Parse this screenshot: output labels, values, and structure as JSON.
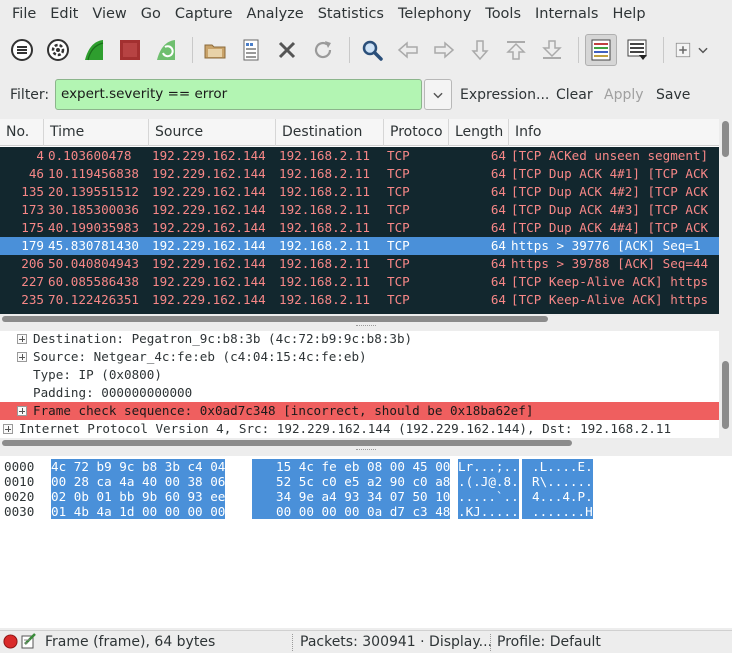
{
  "menu": [
    "File",
    "Edit",
    "View",
    "Go",
    "Capture",
    "Analyze",
    "Statistics",
    "Telephony",
    "Tools",
    "Internals",
    "Help"
  ],
  "toolbar": {
    "icons": [
      "interfaces-icon",
      "options-icon",
      "start-capture-icon",
      "stop-capture-icon",
      "restart-capture-icon",
      "open-file-icon",
      "save-file-icon",
      "close-file-icon",
      "reload-icon",
      "find-icon",
      "go-back-icon",
      "go-forward-icon",
      "go-to-packet-icon",
      "go-first-icon",
      "go-last-icon",
      "colorize-icon",
      "autoscroll-icon",
      "zoom-in-icon"
    ]
  },
  "filter": {
    "label": "Filter:",
    "value": "expert.severity == error",
    "expression_label": "Expression...",
    "clear_label": "Clear",
    "apply_label": "Apply",
    "save_label": "Save"
  },
  "packet_list": {
    "columns": [
      "No.",
      "Time",
      "Source",
      "Destination",
      "Protoco",
      "Length",
      "Info"
    ],
    "rows": [
      {
        "no": "4",
        "time": "0.103600478",
        "src": "192.229.162.144",
        "dst": "192.168.2.11",
        "proto": "TCP",
        "len": "64",
        "info": "[TCP ACKed unseen segment]",
        "style": "err"
      },
      {
        "no": "46",
        "time": "10.119456838",
        "src": "192.229.162.144",
        "dst": "192.168.2.11",
        "proto": "TCP",
        "len": "64",
        "info": "[TCP Dup ACK 4#1] [TCP ACK",
        "style": "err"
      },
      {
        "no": "135",
        "time": "20.139551512",
        "src": "192.229.162.144",
        "dst": "192.168.2.11",
        "proto": "TCP",
        "len": "64",
        "info": "[TCP Dup ACK 4#2] [TCP ACK",
        "style": "err"
      },
      {
        "no": "173",
        "time": "30.185300036",
        "src": "192.229.162.144",
        "dst": "192.168.2.11",
        "proto": "TCP",
        "len": "64",
        "info": "[TCP Dup ACK 4#3] [TCP ACK",
        "style": "err"
      },
      {
        "no": "175",
        "time": "40.199035983",
        "src": "192.229.162.144",
        "dst": "192.168.2.11",
        "proto": "TCP",
        "len": "64",
        "info": "[TCP Dup ACK 4#4] [TCP ACK",
        "style": "err"
      },
      {
        "no": "179",
        "time": "45.830781430",
        "src": "192.229.162.144",
        "dst": "192.168.2.11",
        "proto": "TCP",
        "len": "64",
        "info": "https > 39776 [ACK] Seq=1",
        "style": "sel"
      },
      {
        "no": "206",
        "time": "50.040804943",
        "src": "192.229.162.144",
        "dst": "192.168.2.11",
        "proto": "TCP",
        "len": "64",
        "info": "https > 39788 [ACK] Seq=44",
        "style": "err"
      },
      {
        "no": "227",
        "time": "60.085586438",
        "src": "192.229.162.144",
        "dst": "192.168.2.11",
        "proto": "TCP",
        "len": "64",
        "info": "[TCP Keep-Alive ACK] https",
        "style": "err"
      },
      {
        "no": "235",
        "time": "70.122426351",
        "src": "192.229.162.144",
        "dst": "192.168.2.11",
        "proto": "TCP",
        "len": "64",
        "info": "[TCP Keep-Alive ACK] https",
        "style": "err"
      }
    ]
  },
  "details": [
    {
      "indent": 1,
      "expander": true,
      "text": "Destination: Pegatron_9c:b8:3b (4c:72:b9:9c:b8:3b)",
      "hl": false
    },
    {
      "indent": 1,
      "expander": true,
      "text": "Source: Netgear_4c:fe:eb (c4:04:15:4c:fe:eb)",
      "hl": false
    },
    {
      "indent": 1,
      "expander": false,
      "text": "Type: IP (0x0800)",
      "hl": false
    },
    {
      "indent": 1,
      "expander": false,
      "text": "Padding: 000000000000",
      "hl": false
    },
    {
      "indent": 1,
      "expander": true,
      "text": "Frame check sequence: 0x0ad7c348 [incorrect, should be 0x18ba62ef]",
      "hl": true
    },
    {
      "indent": 0,
      "expander": true,
      "text": "Internet Protocol Version 4, Src: 192.229.162.144 (192.229.162.144), Dst: 192.168.2.11",
      "hl": false
    }
  ],
  "bytes": [
    {
      "offset": "0000",
      "hex1": "4c 72 b9 9c b8 3b c4 04",
      "hex2": "15 4c fe eb 08 00 45 00",
      "ascii1": "Lr...;..",
      "ascii2": ".L....E."
    },
    {
      "offset": "0010",
      "hex1": "00 28 ca 4a 40 00 38 06",
      "hex2": "52 5c c0 e5 a2 90 c0 a8",
      "ascii1": ".(.J@.8.",
      "ascii2": "R\\......"
    },
    {
      "offset": "0020",
      "hex1": "02 0b 01 bb 9b 60 93 ee",
      "hex2": "34 9e a4 93 34 07 50 10",
      "ascii1": ".....`..",
      "ascii2": "4...4.P."
    },
    {
      "offset": "0030",
      "hex1": "01 4b 4a 1d 00 00 00 00",
      "hex2": "00 00 00 00 0a d7 c3 48",
      "ascii1": ".KJ.....",
      "ascii2": ".......H"
    }
  ],
  "status": {
    "frame": "Frame (frame), 64 bytes",
    "packets": "Packets: 300941 · Display...",
    "profile": "Profile: Default"
  },
  "colors": {
    "error_row_bg": "#12272e",
    "error_row_fg": "#f78787",
    "selected_bg": "#4a90d9",
    "filter_valid_bg": "#b3f5b3",
    "highlight_red": "#ef5f5f"
  }
}
